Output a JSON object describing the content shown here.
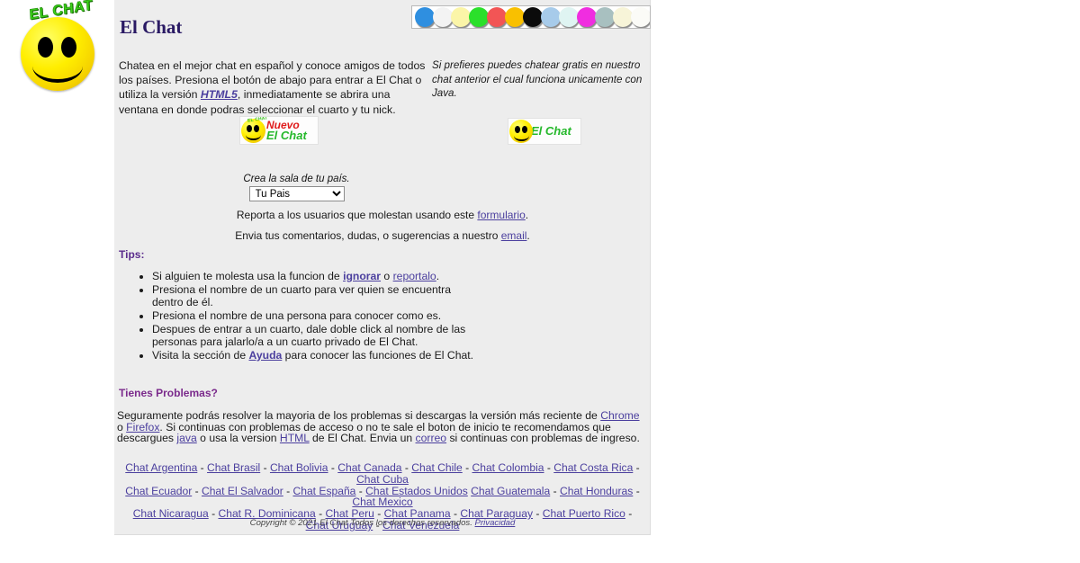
{
  "logo": {
    "banner_text": "EL CHAT",
    "alt": "smiley-face-logo"
  },
  "header": {
    "title": "El Chat"
  },
  "color_strip": {
    "name": "color-palette-strip",
    "swatches": [
      {
        "name": "blue",
        "hex": "#2f8fe0"
      },
      {
        "name": "white",
        "hex": "#f3f3f3"
      },
      {
        "name": "light-yellow",
        "hex": "#fbf5a8"
      },
      {
        "name": "green",
        "hex": "#2be02b"
      },
      {
        "name": "red",
        "hex": "#f25555"
      },
      {
        "name": "gold",
        "hex": "#f9c000"
      },
      {
        "name": "black",
        "hex": "#0b0b0b"
      },
      {
        "name": "light-blue",
        "hex": "#a7cbea"
      },
      {
        "name": "pale-cyan",
        "hex": "#dff4f2"
      },
      {
        "name": "magenta",
        "hex": "#f02de0"
      },
      {
        "name": "gray-blue",
        "hex": "#a8c0c0"
      },
      {
        "name": "cream",
        "hex": "#f7f4d8"
      },
      {
        "name": "off-white",
        "hex": "#fbfbf7"
      }
    ]
  },
  "intro": {
    "left_part1": "Chatea en el mejor chat en español y conoce amigos de todos los países. Presiona el botón de abajo para entrar a El Chat o utiliza la versión ",
    "left_link": "HTML5",
    "left_part2": ", inmediatamente se abrira una ventana en donde podras seleccionar el cuarto y tu nick.",
    "right": "Si prefieres puedes chatear gratis en nuestro chat anterior el cual funciona unicamente con Java."
  },
  "buttons": {
    "nuevo": {
      "mini_text": "EL CHAT",
      "line1": "Nuevo",
      "line2": "El Chat",
      "color_line1": "#e01b1b",
      "color_line2": "#25b82b"
    },
    "java": {
      "label": "El Chat",
      "color": "#25b82b"
    }
  },
  "country_selector": {
    "caption": "Crea la sala de tu país.",
    "selected": "Tu Pais",
    "options": [
      "Tu Pais"
    ]
  },
  "report_line": {
    "before": "Reporta a los usuarios que molestan usando este ",
    "link": "formulario",
    "after": "."
  },
  "email_line": {
    "before": "Envia tus comentarios, dudas, o sugerencias a nuestro ",
    "link": "email",
    "after": "."
  },
  "tips": {
    "heading": "Tips:",
    "items": [
      {
        "before": "Si alguien te molesta usa la funcion de ",
        "link1": "ignorar",
        "middle": " o ",
        "link2": "reportalo",
        "after": "."
      },
      {
        "before": "Presiona el nombre de un cuarto para ver quien se encuentra dentro de él.",
        "link1": "",
        "middle": "",
        "link2": "",
        "after": ""
      },
      {
        "before": "Presiona el nombre de una persona para conocer como es.",
        "link1": "",
        "middle": "",
        "link2": "",
        "after": ""
      },
      {
        "before": "Despues de entrar a un cuarto, dale doble click al nombre de las personas para jalarlo/a a un cuarto privado de El Chat.",
        "link1": "",
        "middle": "",
        "link2": "",
        "after": ""
      },
      {
        "before": "Visita la sección de ",
        "link1": "Ayuda",
        "middle": "",
        "link2": "",
        "after": " para conocer las funciones de El Chat."
      }
    ]
  },
  "problems": {
    "heading": "Tienes Problemas?",
    "p1": "Seguramente podrás resolver la mayoria de los problemas si descargas la versión más reciente de ",
    "link_chrome": "Chrome",
    "p2": " o ",
    "link_firefox": "Firefox",
    "p3": ". Si continuas con problemas de acceso o no te sale el boton de inicio te recomendamos que descargues ",
    "link_java": "java",
    "p4": " o usa la version ",
    "link_html": "HTML",
    "p5": " de El Chat. Envia un ",
    "link_correo": "correo",
    "p6": " si continuas con problemas de ingreso."
  },
  "country_links": {
    "row1": [
      "Chat Argentina",
      "Chat Brasil",
      "Chat Bolivia",
      "Chat Canada",
      "Chat Chile",
      "Chat Colombia",
      "Chat Costa Rica",
      "Chat Cuba"
    ],
    "row2": [
      "Chat Ecuador",
      "Chat El Salvador",
      "Chat España",
      "Chat Estados Unidos",
      "Chat Guatemala",
      "Chat Honduras",
      "Chat Mexico"
    ],
    "row3": [
      "Chat Nicaragua",
      "Chat R. Dominicana",
      "Chat Peru",
      "Chat Panama",
      "Chat Paraguay",
      "Chat Puerto Rico",
      "Chat Uruguay",
      "Chat Venezuela"
    ],
    "separator": " - "
  },
  "footer": {
    "copyright": "Copyright © 2021 El Chat Todos los derechos reservados.",
    "privacy_link": "Privacidad"
  }
}
